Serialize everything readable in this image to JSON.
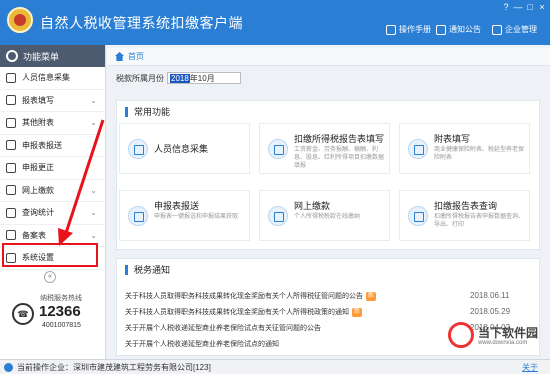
{
  "app": {
    "title": "自然人税收管理系统扣缴客户端"
  },
  "toolbar": {
    "manual": "操作手册",
    "notice": "通知公告",
    "enterprise": "企业管理"
  },
  "sidebar": {
    "header": "功能菜单",
    "items": [
      {
        "label": "人员信息采集",
        "icon": "person-icon",
        "has_children": false
      },
      {
        "label": "报表填写",
        "icon": "edit-icon",
        "has_children": true
      },
      {
        "label": "其他附表",
        "icon": "document-icon",
        "has_children": true
      },
      {
        "label": "申报表报送",
        "icon": "send-icon",
        "has_children": false
      },
      {
        "label": "申报更正",
        "icon": "correction-icon",
        "has_children": false
      },
      {
        "label": "网上缴款",
        "icon": "cart-icon",
        "has_children": true
      },
      {
        "label": "查询统计",
        "icon": "search-icon",
        "has_children": true
      },
      {
        "label": "备案表",
        "icon": "file-icon",
        "has_children": true
      },
      {
        "label": "系统设置",
        "icon": "gear-icon",
        "has_children": false
      }
    ],
    "collapse": "«",
    "hotline_label": "纳税服务热线",
    "hotline_number": "12366",
    "hotline_number2": "4001007815",
    "hotline_icon": "phone-icon"
  },
  "tab": {
    "label": "首页"
  },
  "period": {
    "label": "税款所属月份",
    "value_year": "2018",
    "value_rest": "年10月"
  },
  "common": {
    "title": "常用功能",
    "items": [
      {
        "title": "人员信息采集",
        "desc": ""
      },
      {
        "title": "扣缴所得税报告表填写",
        "desc": "工资薪金、劳务报酬、稿酬、利息、股息、红利所得项目扣缴数据填报"
      },
      {
        "title": "附表填写",
        "desc": "商业健康保险附表、税延型养老保险附表"
      },
      {
        "title": "申报表报送",
        "desc": "申报表一键报送和申报结果获取"
      },
      {
        "title": "网上缴款",
        "desc": "个人所得税税款在线缴纳"
      },
      {
        "title": "扣缴报告表查询",
        "desc": "扣缴所得税报告表申报数据查询、导出、打印"
      }
    ]
  },
  "tax_notice": {
    "title": "税务通知",
    "items": [
      {
        "text": "关于科技人员取得职务科技成果转化现金奖励有关个人所得税征管问题的公告",
        "new": "新",
        "date": "2018.06.11"
      },
      {
        "text": "关于科技人员取得职务科技成果转化现金奖励有关个人所得税政策的通知",
        "new": "新",
        "date": "2018.05.29"
      },
      {
        "text": "关于开展个人税收递延型商业养老保险试点有关征管问题的公告",
        "new": "",
        "date": "2018.04.02"
      },
      {
        "text": "关于开展个人税收递延型商业养老保险试点的通知",
        "new": "",
        "date": ""
      }
    ]
  },
  "status": {
    "company": "当前操作企业：深圳市建茂建筑工程劳务有限公司[123]",
    "about": "关于"
  },
  "watermark": {
    "text": "当下软件园",
    "url": "www.downxia.com"
  },
  "colors": {
    "primary": "#2a7fd4",
    "annotation": "#e8131a",
    "badge": "#ff9a36"
  }
}
